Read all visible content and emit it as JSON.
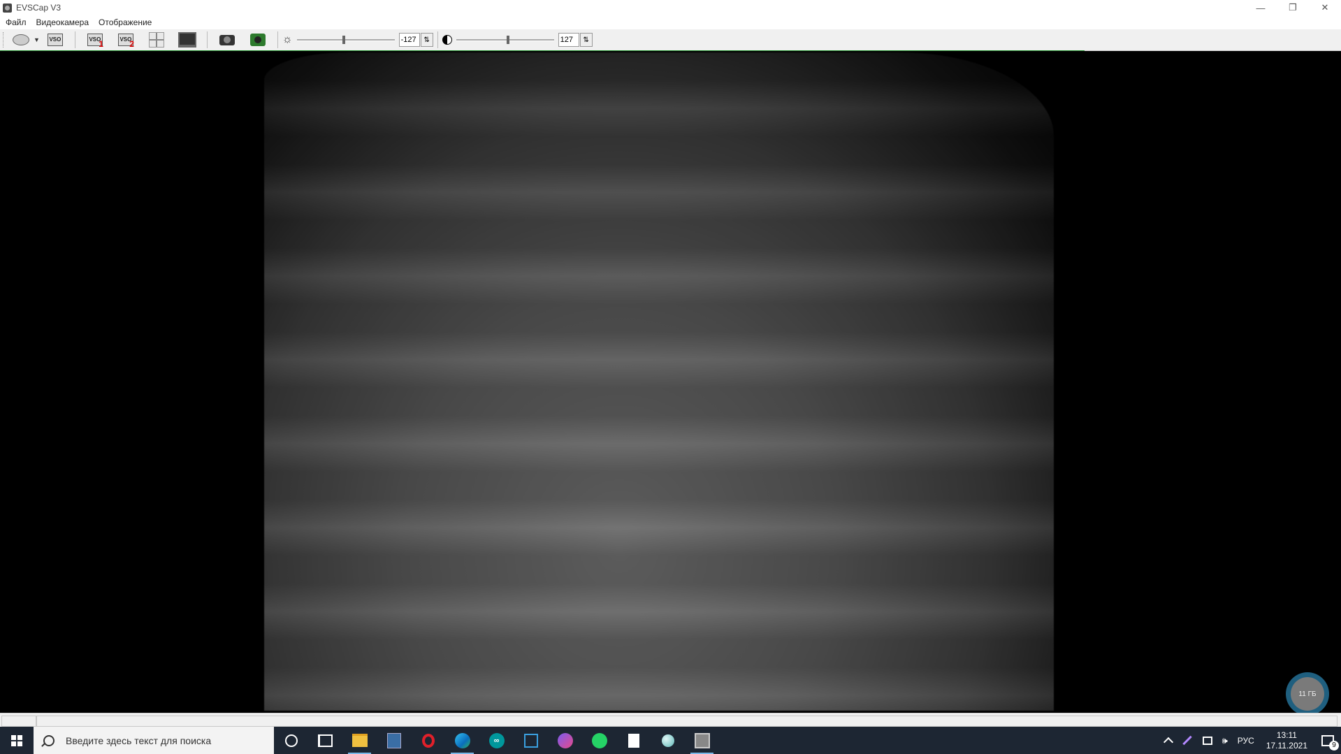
{
  "window": {
    "title": "EVSCap V3",
    "controls": {
      "minimize": "—",
      "restore": "❐",
      "close": "✕"
    }
  },
  "menu": {
    "items": [
      "Файл",
      "Видеокамера",
      "Отображение"
    ]
  },
  "toolbar": {
    "icons": [
      "webcam-icon",
      "dropdown-arrow-icon",
      "video-source-icon",
      "video-input-1-icon",
      "video-input-2-icon",
      "grid-layout-icon",
      "monitor-icon",
      "snapshot-camera-icon",
      "capture-camera-icon",
      "brightness-icon",
      "contrast-icon"
    ],
    "brightness_value": "-127",
    "contrast_value": "127",
    "brightness_level_percent": 48,
    "contrast_level_percent": 53
  },
  "overlay": {
    "badge_text": "11 ГБ"
  },
  "taskbar": {
    "search_placeholder": "Введите здесь текст для поиска",
    "apps": [
      "cortana-icon",
      "task-view-icon",
      "file-explorer-icon",
      "calculator-icon",
      "opera-icon",
      "edge-icon",
      "arduino-icon",
      "app-box-icon",
      "zoom-icon",
      "whatsapp-icon",
      "notepad-icon",
      "app-ball-icon",
      "evscap-icon"
    ],
    "tray": {
      "language": "РУС",
      "time": "13:11",
      "date": "17.11.2021",
      "notification_count": "9"
    }
  },
  "colors": {
    "accent_green": "#2e9a3a",
    "taskbar_bg": "#1d2633",
    "badge_ring": "#1f5f7f"
  }
}
